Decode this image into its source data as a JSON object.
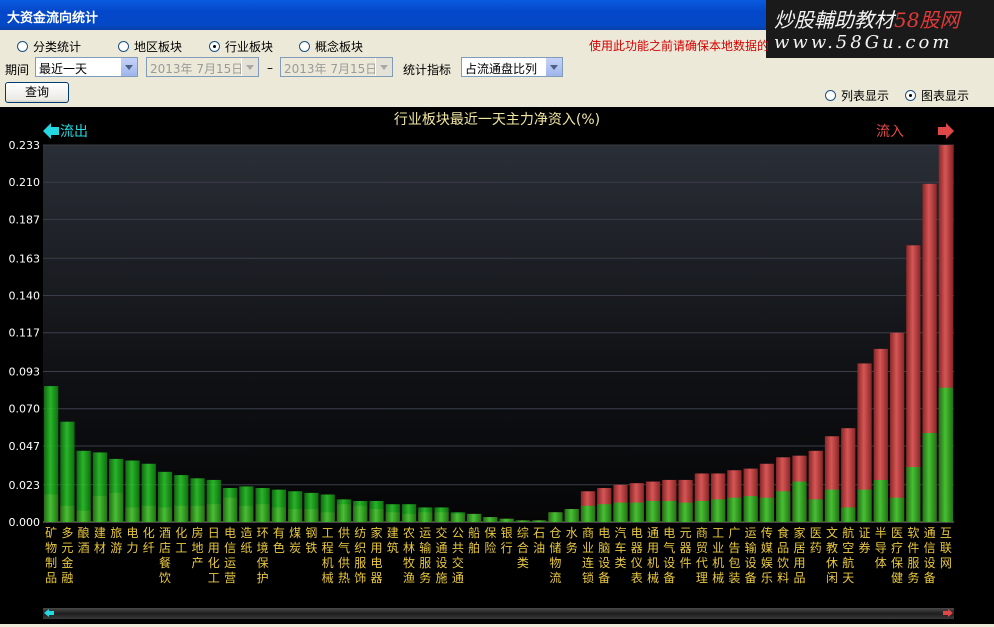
{
  "window": {
    "title": "大资金流向统计"
  },
  "watermark": {
    "line1_black": "炒股輔助教材",
    "line1_red": "58股网",
    "line2": "www.58Gu.com"
  },
  "category_radios": [
    {
      "label": "分类统计",
      "selected": false
    },
    {
      "label": "地区板块",
      "selected": false
    },
    {
      "label": "行业板块",
      "selected": true
    },
    {
      "label": "概念板块",
      "selected": false
    }
  ],
  "warning": "使用此功能之前请确保本地数据的",
  "filters": {
    "period_label": "期间",
    "period_value": "最近一天",
    "start_date": "2013年 7月15日",
    "date_separator": "–",
    "end_date": "2013年 7月15日",
    "metric_label": "统计指标",
    "metric_value": "占流通盘比列"
  },
  "query_button": "查询",
  "display_radios": [
    {
      "label": "列表显示",
      "selected": false
    },
    {
      "label": "图表显示",
      "selected": true
    }
  ],
  "colors": {
    "outflow": "#1EB61E",
    "inflow": "#D64A4A",
    "title": "#F0E6A0",
    "label": "#E8C840",
    "axis": "#FFFFFF",
    "out_arrow": "#23D8E0",
    "in_arrow": "#E04848"
  },
  "chart_data": {
    "type": "bar",
    "title": "行业板块最近一天主力净资入(%)",
    "left_label": "流出",
    "right_label": "流入",
    "ylim": [
      0,
      0.233
    ],
    "y_ticks": [
      "0.000",
      "0.023",
      "0.047",
      "0.070",
      "0.093",
      "0.117",
      "0.140",
      "0.163",
      "0.187",
      "0.210",
      "0.233"
    ],
    "categories": [
      "矿物制品",
      "多元金融",
      "酿酒",
      "建材",
      "旅游",
      "电力",
      "化纤",
      "酒店餐饮",
      "化工",
      "房地产",
      "日用化工",
      "电信运营",
      "造纸",
      "环境保护",
      "有色",
      "煤炭",
      "钢铁",
      "工程机械",
      "供气供热",
      "纺织服饰",
      "家用电器",
      "建筑",
      "农林牧渔",
      "运输服务",
      "交通设施",
      "公共交通",
      "船舶",
      "保险",
      "银行",
      "综合类",
      "石油",
      "仓储物流",
      "水务",
      "商业连锁",
      "电脑设备",
      "汽车类",
      "电器仪表",
      "通用机械",
      "电气设备",
      "元器件",
      "商贸代理",
      "工业机械",
      "广告包装",
      "运输设备",
      "传媒娱乐",
      "食品饮料",
      "家居用品",
      "医药",
      "文教休闲",
      "航空航天",
      "证券",
      "半导体",
      "医疗保健",
      "软件服务",
      "通信设备",
      "互联网"
    ],
    "series": [
      {
        "name": "流出",
        "values": [
          0.084,
          0.062,
          0.044,
          0.043,
          0.039,
          0.038,
          0.036,
          0.031,
          0.029,
          0.027,
          0.026,
          0.021,
          0.022,
          0.021,
          0.02,
          0.019,
          0.018,
          0.017,
          0.014,
          0.013,
          0.013,
          0.011,
          0.011,
          0.009,
          0.009,
          0.006,
          0.005,
          0.003,
          0.002,
          0.001,
          0.001,
          0.006,
          0.008,
          0.01,
          0.011,
          0.012,
          0.012,
          0.013,
          0.013,
          0.012,
          0.013,
          0.014,
          0.015,
          0.016,
          0.015,
          0.019,
          0.025,
          0.014,
          0.02,
          0.009,
          0.02,
          0.026,
          0.015,
          0.034,
          0.055,
          0.083
        ]
      },
      {
        "name": "流入",
        "values": [
          0.017,
          0.01,
          0.007,
          0.016,
          0.018,
          0.009,
          0.01,
          0.009,
          0.01,
          0.01,
          0.011,
          0.015,
          0.01,
          0.011,
          0.009,
          0.008,
          0.008,
          0.006,
          0.011,
          0.01,
          0.008,
          0.006,
          0.005,
          0.006,
          0.006,
          0.005,
          0.005,
          0.003,
          0.002,
          0.001,
          0.001,
          0.006,
          0.008,
          0.019,
          0.021,
          0.023,
          0.024,
          0.025,
          0.026,
          0.026,
          0.03,
          0.03,
          0.032,
          0.033,
          0.036,
          0.04,
          0.041,
          0.044,
          0.053,
          0.058,
          0.098,
          0.107,
          0.117,
          0.171,
          0.209,
          0.233
        ]
      }
    ]
  }
}
